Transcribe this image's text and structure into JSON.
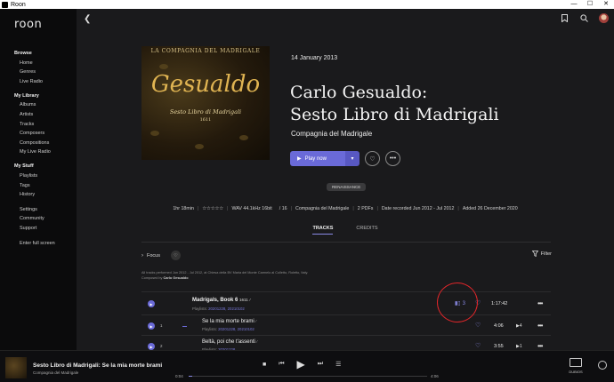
{
  "window": {
    "title": "Roon",
    "min": "—",
    "max": "☐",
    "close": "✕"
  },
  "sidebar": {
    "logo": "roon",
    "browse": {
      "heading": "Browse",
      "items": [
        "Home",
        "Genres",
        "Live Radio"
      ]
    },
    "library": {
      "heading": "My Library",
      "items": [
        "Albums",
        "Artists",
        "Tracks",
        "Composers",
        "Compositions",
        "My Live Radio"
      ]
    },
    "stuff": {
      "heading": "My Stuff",
      "items": [
        "Playlists",
        "Tags",
        "History"
      ]
    },
    "misc": [
      "Settings",
      "Community",
      "Support"
    ],
    "fullscreen": "Enter full screen"
  },
  "header": {
    "back_icon": "chevron-left-icon",
    "icons": [
      "bookmark-icon",
      "search-icon"
    ]
  },
  "album": {
    "cover": {
      "top": "LA COMPAGNIA DEL MADRIGALE",
      "main": "Gesualdo",
      "sub": "Sesto Libro di Madrigali",
      "year": "1611"
    },
    "date": "14 January 2013",
    "title_line1": "Carlo Gesualdo:",
    "title_line2": "Sesto Libro di Madrigali",
    "artist": "Compagnia del Madrigale",
    "play_label": "Play now",
    "badge": "RENAISSANCE"
  },
  "meta": [
    "1hr 18min",
    "☆☆☆☆☆",
    "WAV 44.1kHz 16bit",
    "/ 16",
    "Compagnia del Madrigale",
    "2 PDFs",
    "Date recorded Jun 2012 - Jul 2012",
    "Added 26 December 2020"
  ],
  "tabs": {
    "tracks": "TRACKS",
    "credits": "CREDITS"
  },
  "focus_label": "Focus",
  "filter_label": "Filter",
  "note": {
    "line1": "All tracks performed Jun 2012 - Jul 2012, at Chiesa della BV Maria del Monte Carmelo al Colletto, Roletto, Italy.",
    "line2_prefix": "Composed by",
    "line2_name": "Carlo Gesualdo"
  },
  "tracks": [
    {
      "title": "Madrigals, Book 6",
      "year": "1611",
      "pl_prefix": "Playlists:",
      "pl_links": "20201228, 20210102",
      "count": "3",
      "duration": "1:17:42"
    },
    {
      "num": "1",
      "title": "Se la mia morte brami",
      "pl_prefix": "Playlists:",
      "pl_links": "20201228, 20210102",
      "duration": "4:06"
    },
    {
      "num": "2",
      "title": "Beltà, poi che t'assenti",
      "pl_prefix": "Playlists:",
      "pl_links": "20201228",
      "duration": "3:55"
    }
  ],
  "player": {
    "title": "Sesto Libro di Madrigali: Se la mia morte brami",
    "sub": "Compagnia del Madrigale",
    "elapsed": "0:04",
    "total": "4:06",
    "progress": 0.016,
    "zone": "DUBIOS"
  }
}
